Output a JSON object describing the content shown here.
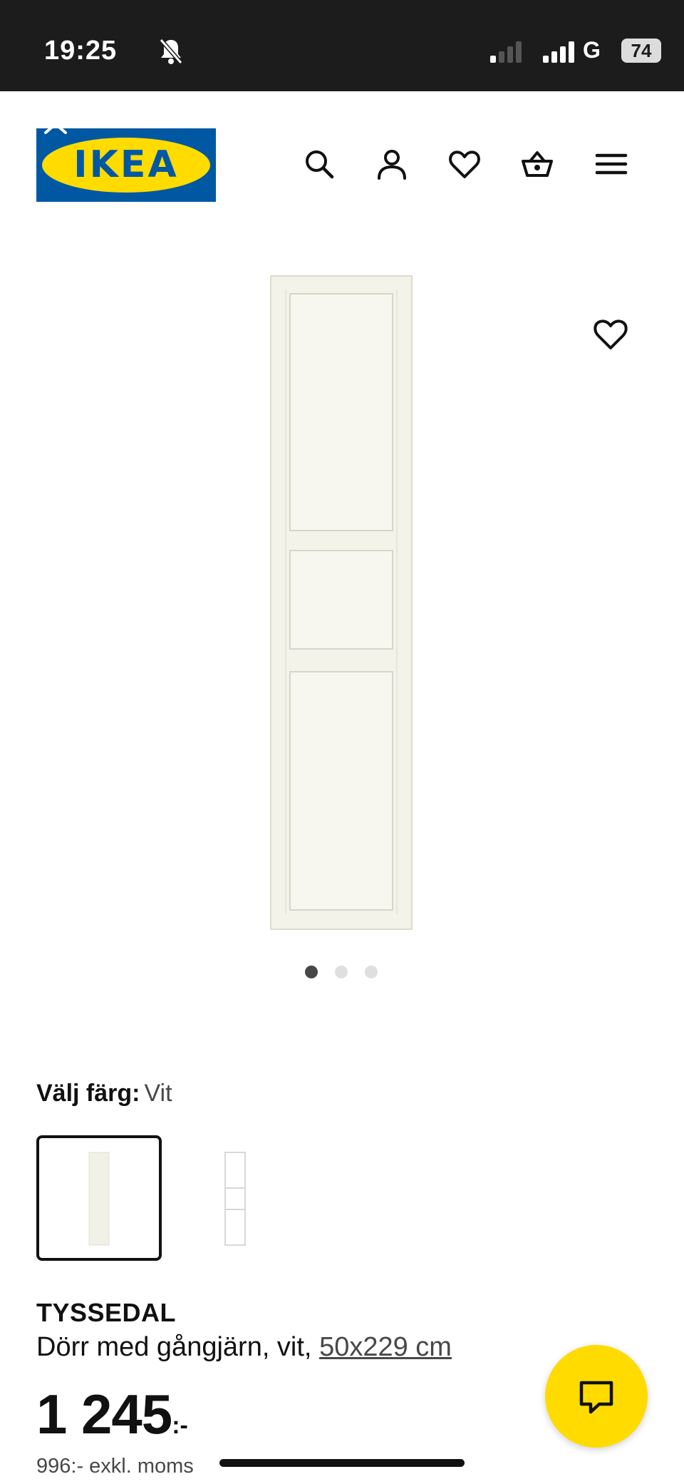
{
  "status_bar": {
    "time": "19:25",
    "network": "G",
    "battery": "74"
  },
  "header": {
    "logo_text": "IKEA",
    "icons": [
      "search-icon",
      "account-icon",
      "favorites-icon",
      "cart-icon",
      "menu-icon"
    ]
  },
  "gallery": {
    "slide_count": 3,
    "active_index": 0
  },
  "color_choice": {
    "label": "Välj färg:",
    "value": "Vit"
  },
  "product": {
    "name": "TYSSEDAL",
    "description": "Dörr med gångjärn, vit, ",
    "size": "50x229 cm",
    "price_main": "1 245",
    "price_suffix": ":-",
    "price_excl_vat": "996:- exkl. moms"
  },
  "colors": {
    "brand_blue": "#0058a3",
    "brand_yellow": "#ffdb00",
    "status_bar": "#1c1c1c"
  }
}
